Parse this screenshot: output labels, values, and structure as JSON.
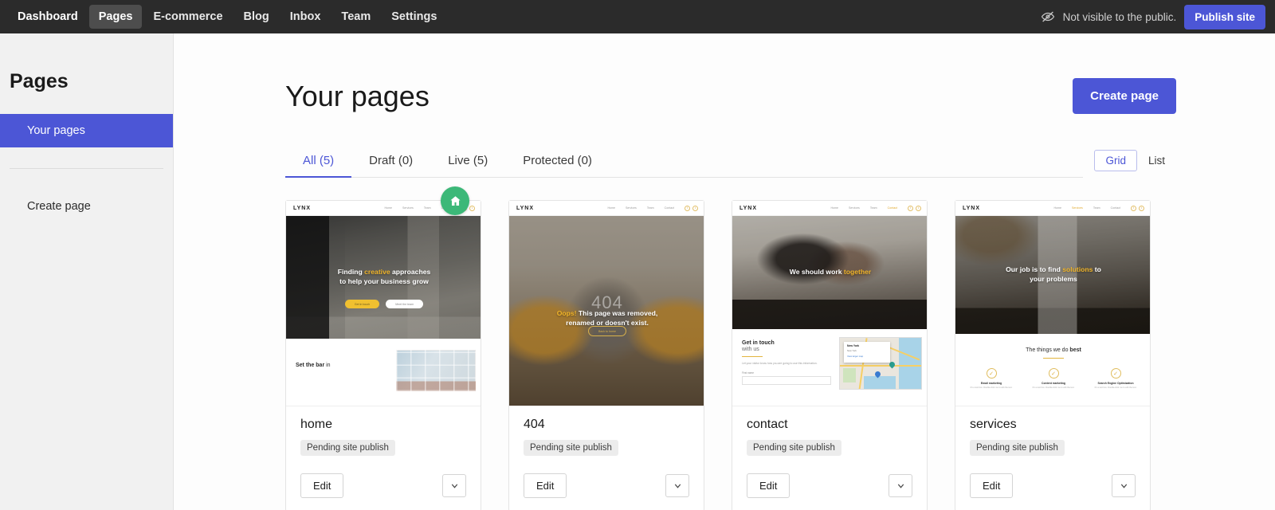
{
  "topnav": {
    "items": [
      {
        "label": "Dashboard",
        "active": false
      },
      {
        "label": "Pages",
        "active": true
      },
      {
        "label": "E-commerce",
        "active": false
      },
      {
        "label": "Blog",
        "active": false
      },
      {
        "label": "Inbox",
        "active": false
      },
      {
        "label": "Team",
        "active": false
      },
      {
        "label": "Settings",
        "active": false
      }
    ],
    "visibility_icon": "eye-off-icon",
    "visibility_text": "Not visible to the public.",
    "publish_label": "Publish site"
  },
  "sidebar": {
    "title": "Pages",
    "items": [
      {
        "label": "Your pages",
        "active": true
      },
      {
        "label": "Create page",
        "active": false
      }
    ]
  },
  "main": {
    "title": "Your pages",
    "create_label": "Create page",
    "tabs": [
      {
        "label": "All (5)",
        "active": true
      },
      {
        "label": "Draft (0)",
        "active": false
      },
      {
        "label": "Live (5)",
        "active": false
      },
      {
        "label": "Protected (0)",
        "active": false
      }
    ],
    "view_toggle": [
      {
        "label": "Grid",
        "active": true
      },
      {
        "label": "List",
        "active": false
      }
    ]
  },
  "colors": {
    "accent": "#4c56d6",
    "topnav_bg": "#2b2b2b",
    "sidebar_bg": "#f1f1f1",
    "home_badge": "#3cb878",
    "badge_bg": "#ececec",
    "site_gold": "#f0b429"
  },
  "cards": [
    {
      "name": "home",
      "status": "Pending site publish",
      "edit_label": "Edit",
      "is_home": true,
      "home_badge_icon": "home-icon",
      "menu_icon": "chevron-down-icon",
      "site": {
        "logo": "LYNX",
        "nav": [
          "Home",
          "Services",
          "Team",
          "Contact"
        ],
        "nav_active": "",
        "hero_line1_pre": "Finding ",
        "hero_line1_hl": "creative",
        "hero_line1_post": " approaches",
        "hero_line2": "to help your business grow",
        "buttons": [
          "Get in touch",
          "Meet the team"
        ],
        "section_title_pre": "Set the bar ",
        "section_title_post": "in"
      }
    },
    {
      "name": "404",
      "status": "Pending site publish",
      "edit_label": "Edit",
      "is_home": false,
      "menu_icon": "chevron-down-icon",
      "site": {
        "logo": "LYNX",
        "nav": [
          "Home",
          "Services",
          "Team",
          "Contact"
        ],
        "nav_active": "",
        "watermark": "404",
        "hero_line1_hl": "Oops!",
        "hero_line1_post": " This page was removed,",
        "hero_line2": "renamed or doesn't exist.",
        "buttons": [
          "Back to home"
        ]
      }
    },
    {
      "name": "contact",
      "status": "Pending site publish",
      "edit_label": "Edit",
      "is_home": false,
      "menu_icon": "chevron-down-icon",
      "site": {
        "logo": "LYNX",
        "nav": [
          "Home",
          "Services",
          "Team",
          "Contact"
        ],
        "nav_active": "Contact",
        "hero_line1_pre": "We should work ",
        "hero_line1_hl": "together",
        "section_title_pre": "Get in touch",
        "section_title_post": "with us",
        "section_sub": "Let your visitor know how you are going to use this information.",
        "field_label": "First name",
        "map": {
          "popup_title": "New York",
          "popup_sub": "New York",
          "popup_link": "View larger map"
        }
      }
    },
    {
      "name": "services",
      "status": "Pending site publish",
      "edit_label": "Edit",
      "is_home": false,
      "menu_icon": "chevron-down-icon",
      "site": {
        "logo": "LYNX",
        "nav": [
          "Home",
          "Services",
          "Team",
          "Contact"
        ],
        "nav_active": "Services",
        "hero_line1_pre": "Our job is to find ",
        "hero_line1_hl": "solutions",
        "hero_line1_post": " to",
        "hero_line2": "your problems",
        "section_title_pre": "The things we do ",
        "section_title_post": "best",
        "features": [
          {
            "icon": "check-circle-icon",
            "name": "Email marketing",
            "desc": "It's a text box. Double-click me to edit the text."
          },
          {
            "icon": "check-circle-icon",
            "name": "Content marketing",
            "desc": "It's a text box. Double-click me to edit the text."
          },
          {
            "icon": "check-circle-icon",
            "name": "Search Engine Optimization",
            "desc": "It's a text box. Double-click me to edit the text."
          }
        ]
      }
    }
  ]
}
